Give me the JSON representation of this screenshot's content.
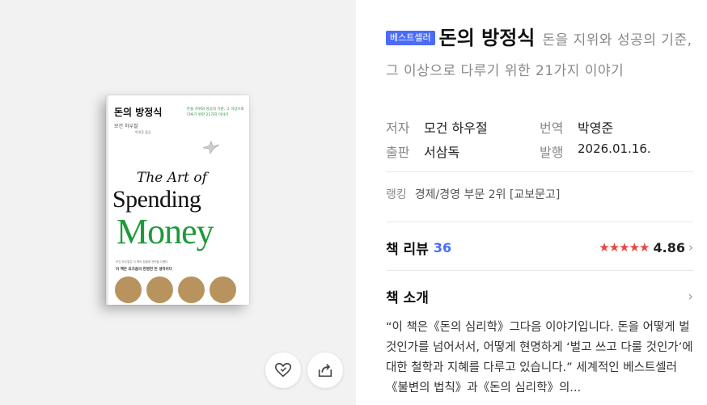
{
  "book": {
    "badge": "베스트셀러",
    "title": "돈의 방정식",
    "subtitle": "돈을 지위와 성공의 기준, 그 이상으로 다루기 위한 21가지 이야기",
    "cover": {
      "title": "돈의 방정식",
      "author": "모건 하우절",
      "translator": "박영준 옮김",
      "tagline": "돈을 지위와 성공의 기준, 그 이상으로 다루기 위한 21가지 이야기",
      "art_of": "The Art of",
      "spending": "Spending",
      "money": "Money",
      "blurb_small": "모건 하우절은 이 책의 집필에 전력을 다했다",
      "blurb_bold": "이 책은 요즈음의 현명한 돈 생각이다"
    }
  },
  "meta": {
    "author_label": "저자",
    "author": "모건 하우절",
    "translator_label": "번역",
    "translator": "박영준",
    "publisher_label": "출판",
    "publisher": "서삼독",
    "date_label": "발행",
    "date": "2026.01.16."
  },
  "ranking": {
    "label": "랭킹",
    "value": "경제/경영 부문 2위 [교보문고]"
  },
  "review": {
    "label": "책 리뷰",
    "count": "36",
    "stars": "★★★★★",
    "score": "4.86",
    "chevron": "›"
  },
  "intro": {
    "label": "책 소개",
    "chevron": "›",
    "text": "“이 책은《돈의 심리학》그다음 이야기입니다. 돈을 어떻게 벌 것인가를 넘어서서, 어떻게 현명하게 ‘벌고 쓰고 다룰 것인가’에 대한 철학과 지혜를 다루고 있습니다.” 세계적인 베스트셀러《불변의 법칙》과《돈의 심리학》의..."
  },
  "actions": {
    "like_icon": "heart-icon",
    "share_icon": "share-icon"
  },
  "colors": {
    "accent": "#4a6cf7",
    "star": "#e8463f",
    "money_green": "#1e9a3a"
  }
}
